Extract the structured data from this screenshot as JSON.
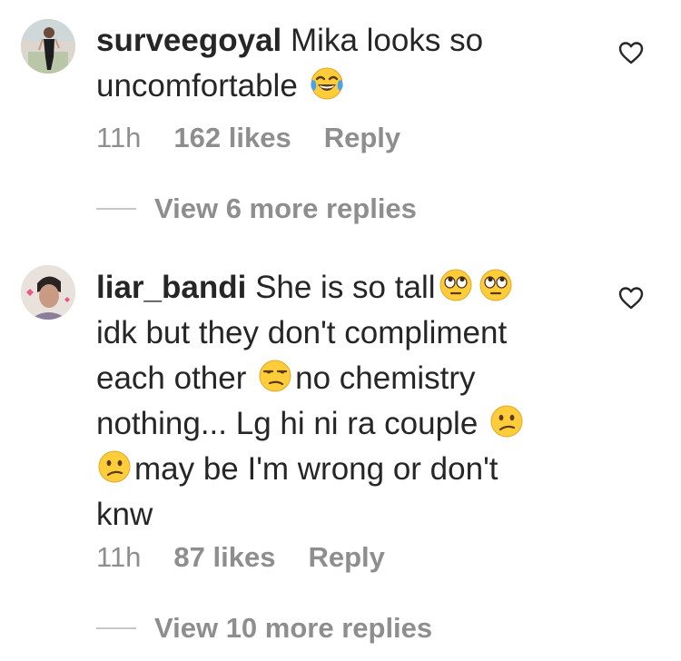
{
  "comments": [
    {
      "username": "surveegoyal",
      "text_lines": [
        "Mika looks so",
        "uncomfortable"
      ],
      "emoji_after_line2": "face-with-tears-of-joy",
      "time": "11h",
      "likes": "162 likes",
      "reply": "Reply",
      "view_more": "View 6 more replies"
    },
    {
      "username": "liar_bandi",
      "line1": "She is so tall",
      "line2": "idk but they don't compliment",
      "line3a": "each other",
      "line3b": "no chemistry",
      "line4": "nothing... Lg hi ni ra couple",
      "line5": "may be I'm wrong or don't",
      "line6": "knw",
      "time": "11h",
      "likes": "87 likes",
      "reply": "Reply",
      "view_more": "View 10 more replies"
    }
  ],
  "icons": {
    "heart": "heart-outline-icon",
    "rolling_eyes": "face-with-rolling-eyes",
    "unamused": "unamused-face",
    "confused": "confused-face"
  },
  "colors": {
    "text": "#262626",
    "secondary": "#8e8e8e",
    "emoji_yellow": "#ffcc3a"
  }
}
